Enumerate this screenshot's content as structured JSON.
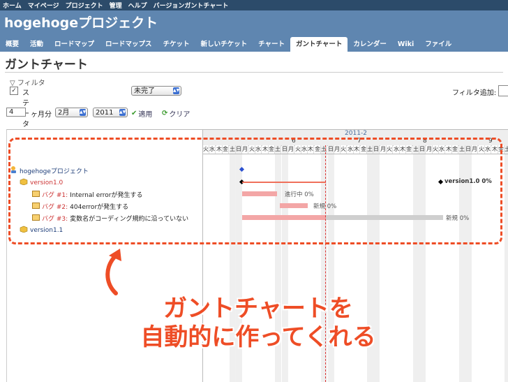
{
  "topbar": {
    "items": [
      "ホーム",
      "マイページ",
      "プロジェクト",
      "管理",
      "ヘルプ",
      "バージョンガントチャート"
    ]
  },
  "header": {
    "project_title": "hogehogeプロジェクト"
  },
  "tabs": [
    "概要",
    "活動",
    "ロードマップ",
    "ロードマップス",
    "チケット",
    "新しいチケット",
    "チャート",
    "ガントチャート",
    "カレンダー",
    "Wiki",
    "ファイル"
  ],
  "active_tab": "ガントチャート",
  "page": {
    "title": "ガントチャート"
  },
  "filter": {
    "legend": "フィルタ",
    "status_label": "ステータス",
    "status_checked": true,
    "status_value": "未完了",
    "add_label": "フィルタ追加:"
  },
  "period": {
    "months_value": "4",
    "months_label": "ヶ月分",
    "month_select": "2月",
    "year_select": "2011",
    "apply_label": "適用",
    "clear_label": "クリア"
  },
  "gantt": {
    "month_label": "2011-2",
    "week_labels": [
      "6",
      "7",
      "8",
      "9"
    ],
    "day_labels": [
      "火",
      "水",
      "木",
      "金",
      "土",
      "日",
      "月",
      "火",
      "水",
      "木",
      "金",
      "土",
      "日",
      "月",
      "火",
      "水",
      "木",
      "金",
      "土",
      "日",
      "月",
      "火",
      "水",
      "木",
      "金",
      "土",
      "日",
      "月",
      "火",
      "水",
      "木",
      "金",
      "土",
      "日",
      "月",
      "火",
      "水",
      "木",
      "金",
      "土",
      "日",
      "月",
      "火",
      "水",
      "木",
      "金",
      "土",
      "日"
    ],
    "project": "hogehogeプロジェクト",
    "version1": "version1.0",
    "version1_bar_label": "version1.0 0%",
    "issues": [
      {
        "tracker": "バグ #1:",
        "subject": "Internal errorが発生する",
        "status_text": "進行中 0%"
      },
      {
        "tracker": "バグ #2:",
        "subject": "404errorが発生する",
        "status_text": "新規 0%"
      },
      {
        "tracker": "バグ #3:",
        "subject": "変数名がコーディング規約に沿っていない",
        "status_text": "新規 0%"
      }
    ],
    "version2": "version1.1"
  },
  "caption": {
    "line1": "ガントチャートを",
    "line2": "自動的に作ってくれる"
  },
  "colors": {
    "header": "#5f86b0",
    "topbar": "#2c4b6a",
    "accent": "#ee4d26",
    "late_bar": "#f3a6a6"
  }
}
